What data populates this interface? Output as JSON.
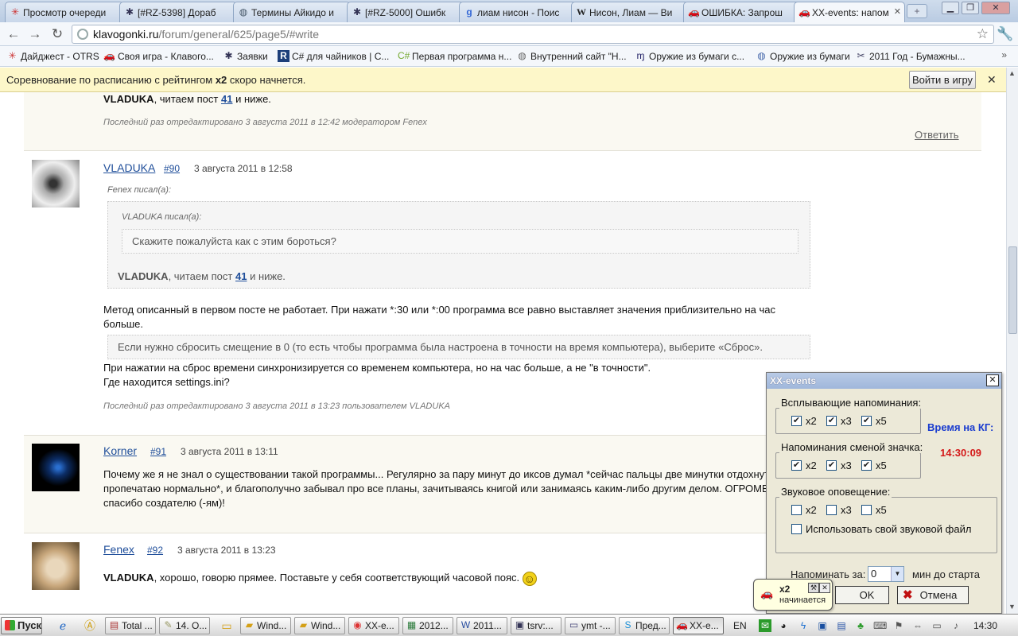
{
  "browser": {
    "tabs": [
      {
        "title": "Просмотр очереди",
        "icon": "otrs-icon"
      },
      {
        "title": "[#RZ-5398] Дораб",
        "icon": "jira-icon"
      },
      {
        "title": "Термины Айкидо и",
        "icon": "globe-icon"
      },
      {
        "title": "[#RZ-5000] Ошибк",
        "icon": "jira-icon"
      },
      {
        "title": "лиам нисон - Поис",
        "icon": "google-icon"
      },
      {
        "title": "Нисон, Лиам — Ви",
        "icon": "wikipedia-icon"
      },
      {
        "title": "ОШИБКА: Запрош",
        "icon": "klavogonki-car-icon"
      },
      {
        "title": "XX-events: напоми",
        "icon": "klavogonki-car-icon"
      }
    ],
    "url_host": "klavogonki.ru",
    "url_path": "/forum/general/625/page5/#write",
    "bookmarks": [
      {
        "label": "Дайджест - OTRS",
        "icon": "otrs-icon"
      },
      {
        "label": "Своя игра - Клавого...",
        "icon": "klavogonki-car-icon"
      },
      {
        "label": "Заявки",
        "icon": "jira-icon"
      },
      {
        "label": "C# для чайников | C...",
        "icon": "r-icon"
      },
      {
        "label": "Первая программа н...",
        "icon": "csharp-icon"
      },
      {
        "label": "Внутренний сайт \"Н...",
        "icon": "globe-icon"
      },
      {
        "label": "Оружие из бумаги с...",
        "icon": "bookmark-icon"
      },
      {
        "label": "Оружие из бумаги",
        "icon": "globe-icon"
      },
      {
        "label": "2011 Год - Бумажны...",
        "icon": "scissors-icon"
      }
    ],
    "bookmarks_more": "»"
  },
  "infobar": {
    "text_before": "Соревнование по расписанию с рейтингом ",
    "text_bold": "x2",
    "text_after": " скоро начнется.",
    "button": "Войти в игру",
    "close": "✕"
  },
  "posts": [
    {
      "id": "top",
      "author_bold": "VLADUKA",
      "text": ", читаем пост ",
      "link": "41",
      "text_after": " и ниже.",
      "edited": "Последний раз отредактировано 3 августа 2011 в 12:42 модератором Fenex",
      "reply": "Ответить"
    },
    {
      "id": "p90",
      "author": "VLADUKA",
      "num": "#90",
      "date": "3 августа 2011 в 12:58",
      "quote_outer_head": "Fenex писал(а):",
      "quote_inner_head": "VLADUKA писал(а):",
      "quote_inner_text": "Скажите пожалуйста как с этим бороться?",
      "quote_mid_bold": "VLADUKA",
      "quote_mid_text": ", читаем пост ",
      "quote_mid_link": "41",
      "quote_mid_after": " и ниже.",
      "body1": "Метод описанный в первом посте не работает. При нажати *:30 или *:00 программа все равно выставляет значения приблизительно на час",
      "body1b": "больше.",
      "quote2": "Если нужно сбросить смещение в 0 (то есть чтобы программа была настроена в точности на время компьютера), выберите «Сброс».",
      "body2": "При нажатии на сброс времени синхронизируется со временем компьютера, но на час больше, а не \"в точности\".",
      "body3": "Где находится settings.ini?",
      "edited": "Последний раз отредактировано 3 августа 2011 в 13:23 пользователем VLADUKA"
    },
    {
      "id": "p91",
      "author": "Korner",
      "num": "#91",
      "date": "3 августа 2011 в 13:11",
      "body1": "Почему же я не знал о существовании такой программы... Регулярно за пару минут до иксов думал *сейчас пальцы две минутки отдохнут,",
      "body2": "пропечатаю нормально*, и благополучно забывал про все планы, зачитываясь книгой или занимаясь каким-либо другим делом. ОГРОМЕНН",
      "body3": "спасибо создателю (-ям)!"
    },
    {
      "id": "p92",
      "author": "Fenex",
      "num": "#92",
      "date": "3 августа 2011 в 13:23",
      "author_bold": "VLADUKA",
      "body": ", хорошо, говорю прямее. Поставьте у себя соответствующий часовой пояс.",
      "smiley": "☺"
    }
  ],
  "xx_events": {
    "title": "XX-events",
    "close": "✕",
    "popup_group": "Всплывающие напоминания:",
    "icon_group": "Напоминания сменой значка:",
    "sound_group": "Звуковое оповещение:",
    "popup_checks": [
      {
        "label": "x2",
        "checked": true
      },
      {
        "label": "x3",
        "checked": true
      },
      {
        "label": "x5",
        "checked": true
      }
    ],
    "icon_checks": [
      {
        "label": "x2",
        "checked": true
      },
      {
        "label": "x3",
        "checked": true
      },
      {
        "label": "x5",
        "checked": true
      }
    ],
    "sound_checks": [
      {
        "label": "x2",
        "checked": false
      },
      {
        "label": "x3",
        "checked": false
      },
      {
        "label": "x5",
        "checked": false
      }
    ],
    "own_sound": "Использовать свой звуковой файл",
    "kg_time_label": "Время на КГ:",
    "kg_time": "14:30:09",
    "remind_label": "Напоминать за:",
    "remind_value": "0",
    "remind_after": "мин до старта",
    "ok": "OK",
    "cancel": "Отмена"
  },
  "tray_popup": {
    "title": "x2",
    "subtitle": "начинается"
  },
  "taskbar": {
    "start": "Пуск",
    "items": [
      {
        "label": "Total ...",
        "icon": "total-commander-icon"
      },
      {
        "label": "14. O...",
        "icon": "pencil-icon"
      },
      {
        "label": "Wind...",
        "icon": "folder-icon"
      },
      {
        "label": "Wind...",
        "icon": "folder-icon"
      },
      {
        "label": "XX-e...",
        "icon": "chrome-icon"
      },
      {
        "label": "2012...",
        "icon": "excel-icon"
      },
      {
        "label": "2011...",
        "icon": "word-icon"
      },
      {
        "label": "tsrv:...",
        "icon": "terminal-icon"
      },
      {
        "label": "ymt -...",
        "icon": "window-icon"
      },
      {
        "label": "Пред...",
        "icon": "skype-icon"
      },
      {
        "label": "XX-e...",
        "icon": "klavogonki-car-icon"
      }
    ],
    "lang": "EN",
    "clock": "14:30"
  }
}
